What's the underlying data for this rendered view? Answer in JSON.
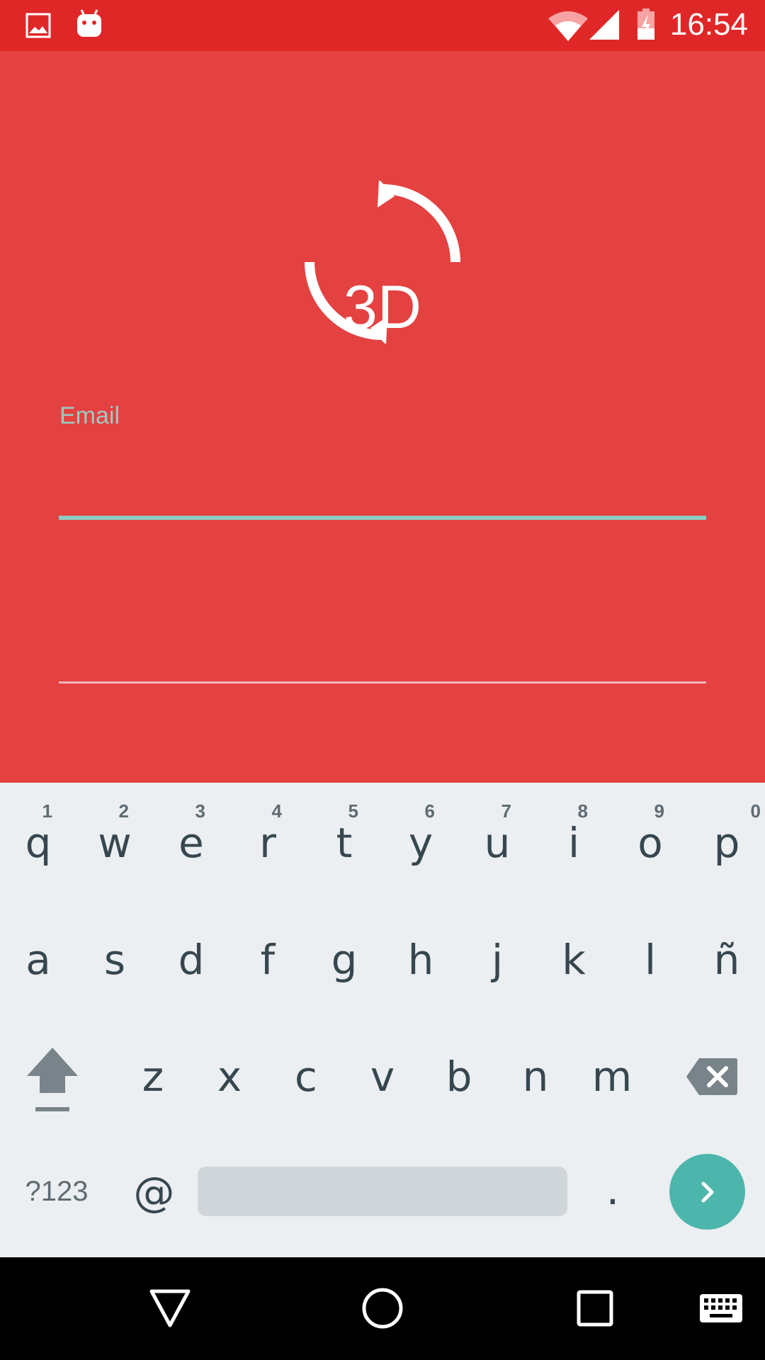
{
  "status_bar": {
    "time": "16:54",
    "icons": [
      "image-icon",
      "android-icon",
      "wifi-icon",
      "cell-signal-icon",
      "battery-charging-icon"
    ]
  },
  "app": {
    "logo_text": "3D",
    "email_label": "Email",
    "email_value": "",
    "password_value": "",
    "colors": {
      "background": "#e44141",
      "statusbar": "#e02728",
      "accent": "#8ecbc4"
    }
  },
  "keyboard": {
    "row1": [
      {
        "key": "q",
        "hint": "1"
      },
      {
        "key": "w",
        "hint": "2"
      },
      {
        "key": "e",
        "hint": "3"
      },
      {
        "key": "r",
        "hint": "4"
      },
      {
        "key": "t",
        "hint": "5"
      },
      {
        "key": "y",
        "hint": "6"
      },
      {
        "key": "u",
        "hint": "7"
      },
      {
        "key": "i",
        "hint": "8"
      },
      {
        "key": "o",
        "hint": "9"
      },
      {
        "key": "p",
        "hint": "0"
      }
    ],
    "row2": [
      "a",
      "s",
      "d",
      "f",
      "g",
      "h",
      "j",
      "k",
      "l",
      "ñ"
    ],
    "row3": [
      "z",
      "x",
      "c",
      "v",
      "b",
      "n",
      "m"
    ],
    "symbols_label": "?123",
    "at_label": "@",
    "period_label": ".",
    "enter_color": "#4db6ac"
  },
  "nav_bar": {
    "icons": [
      "back-icon",
      "home-icon",
      "recents-icon",
      "keyboard-icon"
    ]
  }
}
